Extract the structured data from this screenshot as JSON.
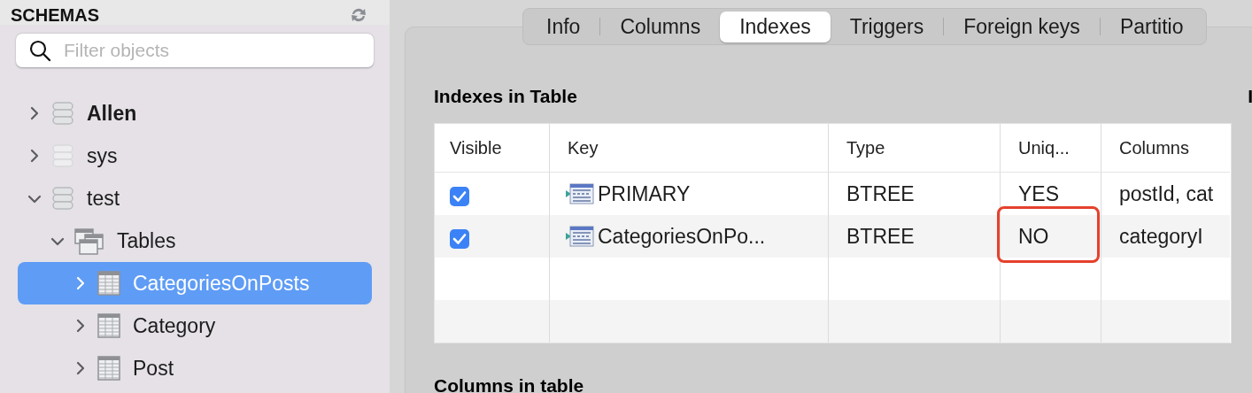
{
  "sidebar": {
    "title": "SCHEMAS",
    "search": {
      "placeholder": "Filter objects"
    },
    "tree": [
      {
        "kind": "schema",
        "label": "Allen",
        "default": true,
        "faded": false,
        "expanded": false,
        "selected": false
      },
      {
        "kind": "schema",
        "label": "sys",
        "default": false,
        "faded": true,
        "expanded": false,
        "selected": false
      },
      {
        "kind": "schema",
        "label": "test",
        "default": false,
        "faded": false,
        "expanded": true,
        "selected": false,
        "children": [
          {
            "kind": "folder",
            "label": "Tables",
            "expanded": true,
            "selected": false,
            "children": [
              {
                "kind": "table",
                "label": "CategoriesOnPosts",
                "expanded": false,
                "selected": true
              },
              {
                "kind": "table",
                "label": "Category",
                "expanded": false,
                "selected": false
              },
              {
                "kind": "table",
                "label": "Post",
                "expanded": false,
                "selected": false
              }
            ]
          }
        ]
      }
    ]
  },
  "tabs": [
    {
      "label": "Info",
      "selected": false
    },
    {
      "label": "Columns",
      "selected": false
    },
    {
      "label": "Indexes",
      "selected": true
    },
    {
      "label": "Triggers",
      "selected": false
    },
    {
      "label": "Foreign keys",
      "selected": false
    },
    {
      "label": "Partitio",
      "selected": false
    }
  ],
  "indexes": {
    "title": "Indexes in Table",
    "side_title": "I",
    "columns": [
      "Visible",
      "Key",
      "Type",
      "Uniq...",
      "Columns"
    ],
    "rows": [
      {
        "visible": true,
        "key": "PRIMARY",
        "type": "BTREE",
        "unique": "YES",
        "columns": "postId, cat",
        "highlighted": false
      },
      {
        "visible": true,
        "key": "CategoriesOnPo...",
        "type": "BTREE",
        "unique": "NO",
        "columns": "categoryI",
        "highlighted": true
      }
    ]
  },
  "columns_section": {
    "title": "Columns in table"
  }
}
